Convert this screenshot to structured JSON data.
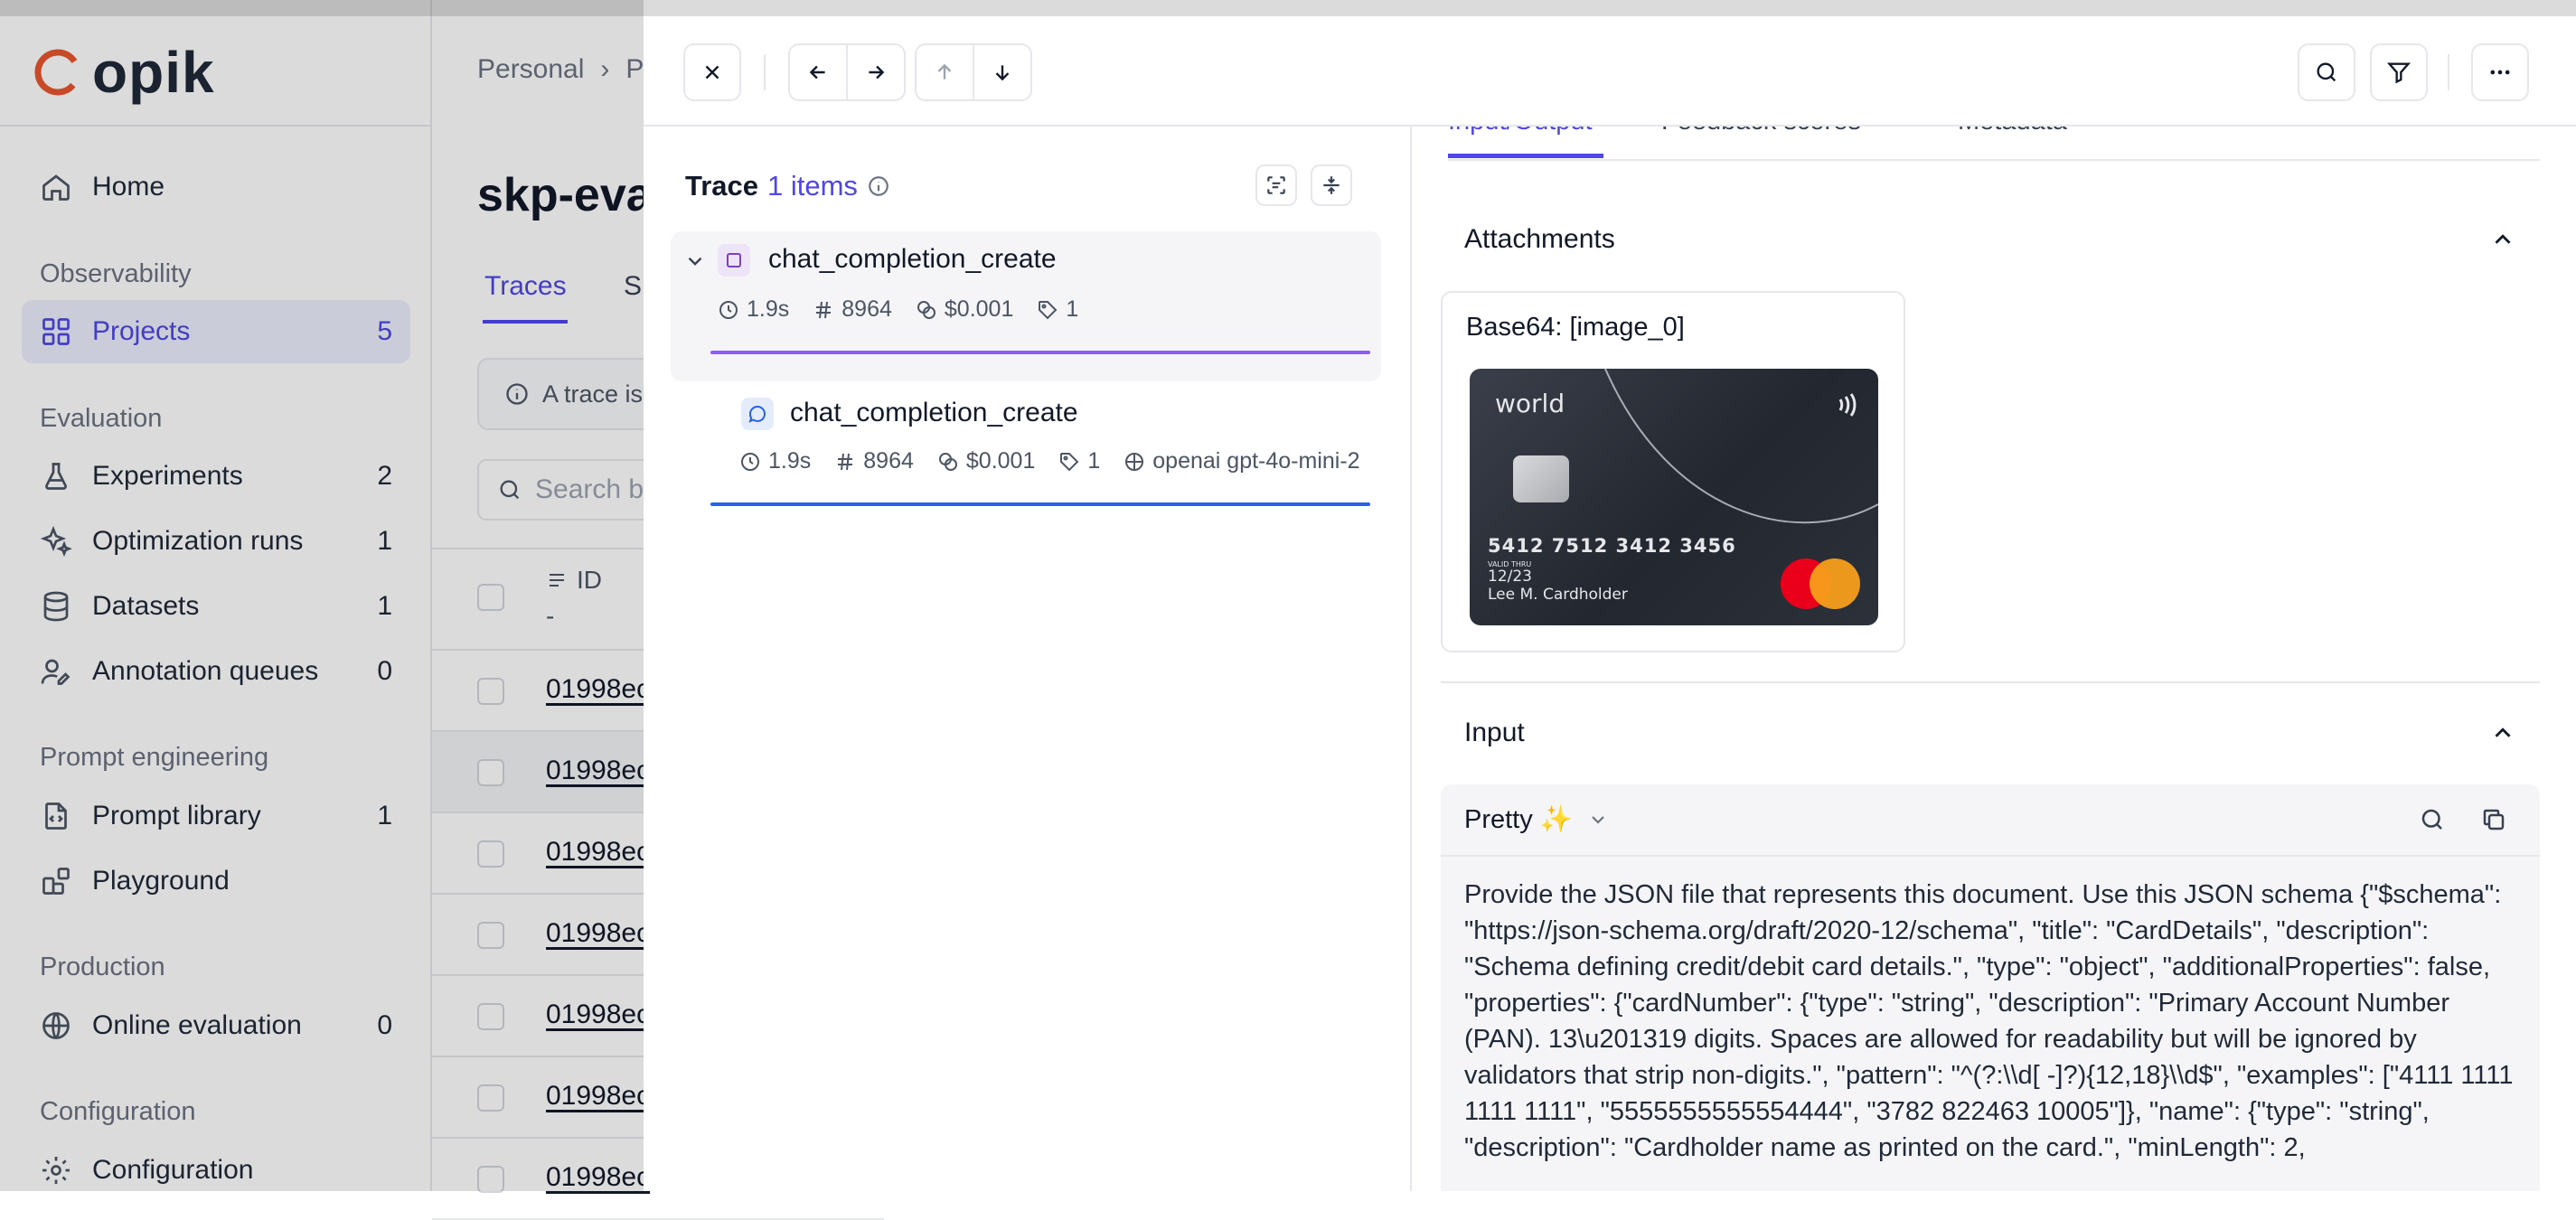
{
  "app": {
    "logo_text": "opik",
    "brand_color": "#e8552f",
    "accent_color": "#4f46e5"
  },
  "sidebar": {
    "home": "Home",
    "sections": {
      "observability": "Observability",
      "evaluation": "Evaluation",
      "prompt_engineering": "Prompt engineering",
      "production": "Production",
      "configuration": "Configuration"
    },
    "items": {
      "projects": {
        "label": "Projects",
        "count": "5"
      },
      "experiments": {
        "label": "Experiments",
        "count": "2"
      },
      "optimization_runs": {
        "label": "Optimization runs",
        "count": "1"
      },
      "datasets": {
        "label": "Datasets",
        "count": "1"
      },
      "annotation_queues": {
        "label": "Annotation queues",
        "count": "0"
      },
      "prompt_library": {
        "label": "Prompt library",
        "count": "1"
      },
      "playground": {
        "label": "Playground"
      },
      "online_evaluation": {
        "label": "Online evaluation",
        "count": "0"
      },
      "configuration": {
        "label": "Configuration"
      }
    }
  },
  "main": {
    "breadcrumb": {
      "root": "Personal",
      "next": "P"
    },
    "title": "skp-eva",
    "tabs": {
      "traces": "Traces",
      "second": "S"
    },
    "notice": "A trace is",
    "search_placeholder": "Search b",
    "table": {
      "id_header": "ID",
      "id_sub": "-",
      "row_id": "01998ec"
    }
  },
  "drawer": {
    "trace": {
      "title": "Trace",
      "count_label": "1 items"
    },
    "root_span": {
      "name": "chat_completion_create",
      "duration": "1.9s",
      "tokens": "8964",
      "cost": "$0.001",
      "tags": "1"
    },
    "child_span": {
      "name": "chat_completion_create",
      "duration": "1.9s",
      "tokens": "8964",
      "cost": "$0.001",
      "tags": "1",
      "model": "openai gpt-4o-mini-2"
    },
    "tabs": {
      "input_output": "Input/Output",
      "feedback": "Feedback scores",
      "metadata": "Metadata"
    },
    "attachments": {
      "title": "Attachments",
      "item_label": "Base64: [image_0]",
      "card": {
        "brand": "world",
        "number": "5412 7512 3412 3456",
        "valid_thru": "VALID THRU",
        "expiry": "12/23",
        "holder": "Lee M. Cardholder"
      }
    },
    "input": {
      "title": "Input",
      "format": "Pretty",
      "format_emoji": "✨",
      "text": "Provide the JSON file that represents this document. Use this JSON schema {\"$schema\": \"https://json-schema.org/draft/2020-12/schema\", \"title\": \"CardDetails\", \"description\": \"Schema defining credit/debit card details.\", \"type\": \"object\", \"additionalProperties\": false, \"properties\": {\"cardNumber\": {\"type\": \"string\", \"description\": \"Primary Account Number (PAN). 13\\u201319 digits. Spaces are allowed for readability but will be ignored by validators that strip non-digits.\", \"pattern\": \"^(?:\\\\d[ -]?){12,18}\\\\d$\", \"examples\": [\"4111 1111 1111 1111\", \"5555555555554444\", \"3782 822463 10005\"]}, \"name\": {\"type\": \"string\", \"description\": \"Cardholder name as printed on the card.\", \"minLength\": 2,"
    }
  }
}
